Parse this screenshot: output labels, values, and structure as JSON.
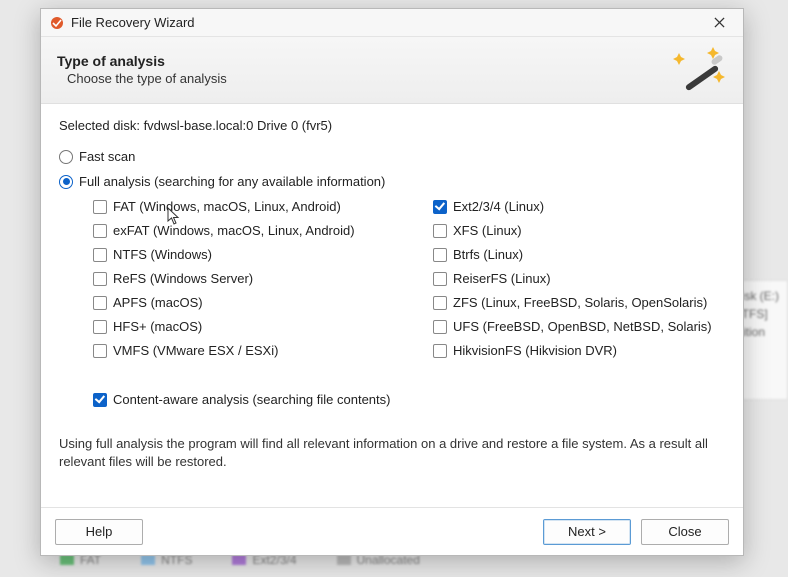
{
  "window": {
    "title": "File Recovery Wizard"
  },
  "header": {
    "heading": "Type of analysis",
    "sub": "Choose the type of analysis"
  },
  "selected_disk": {
    "label": "Selected disk:",
    "value": "fvdwsl-base.local:0 Drive 0 (fvr5)"
  },
  "radios": {
    "fast": {
      "label": "Fast scan",
      "selected": false
    },
    "full": {
      "label": "Full analysis (searching for any available information)",
      "selected": true
    }
  },
  "filesystems": {
    "left": [
      {
        "key": "fat",
        "label": "FAT (Windows, macOS, Linux, Android)",
        "checked": false
      },
      {
        "key": "exfat",
        "label": "exFAT (Windows, macOS, Linux, Android)",
        "checked": false
      },
      {
        "key": "ntfs",
        "label": "NTFS (Windows)",
        "checked": false
      },
      {
        "key": "refs",
        "label": "ReFS (Windows Server)",
        "checked": false
      },
      {
        "key": "apfs",
        "label": "APFS (macOS)",
        "checked": false
      },
      {
        "key": "hfs",
        "label": "HFS+ (macOS)",
        "checked": false
      },
      {
        "key": "vmfs",
        "label": "VMFS (VMware ESX / ESXi)",
        "checked": false
      }
    ],
    "right": [
      {
        "key": "ext",
        "label": "Ext2/3/4 (Linux)",
        "checked": true
      },
      {
        "key": "xfs",
        "label": "XFS (Linux)",
        "checked": false
      },
      {
        "key": "btrfs",
        "label": "Btrfs (Linux)",
        "checked": false
      },
      {
        "key": "reiser",
        "label": "ReiserFS (Linux)",
        "checked": false
      },
      {
        "key": "zfs",
        "label": "ZFS (Linux, FreeBSD, Solaris, OpenSolaris)",
        "checked": false
      },
      {
        "key": "ufs",
        "label": "UFS (FreeBSD, OpenBSD, NetBSD, Solaris)",
        "checked": false
      },
      {
        "key": "hikfs",
        "label": "HikvisionFS (Hikvision DVR)",
        "checked": false
      }
    ]
  },
  "content_aware": {
    "label": "Content-aware analysis (searching file contents)",
    "checked": true
  },
  "description": "Using full analysis the program will find all relevant information on a drive and restore a file system. As a result all relevant files will be restored.",
  "buttons": {
    "help": "Help",
    "next": "Next >",
    "close": "Close"
  },
  "background": {
    "right_panel": {
      "line1": "Disk (E:)",
      "line2": "NTFS]",
      "line3": "irtition"
    },
    "legend": [
      {
        "color": "#37b24d",
        "label": "FAT"
      },
      {
        "color": "#6fb8ef",
        "label": "NTFS"
      },
      {
        "color": "#9a4fd6",
        "label": "Ext2/3/4"
      },
      {
        "color": "#a6a6a6",
        "label": "Unallocated"
      }
    ]
  }
}
